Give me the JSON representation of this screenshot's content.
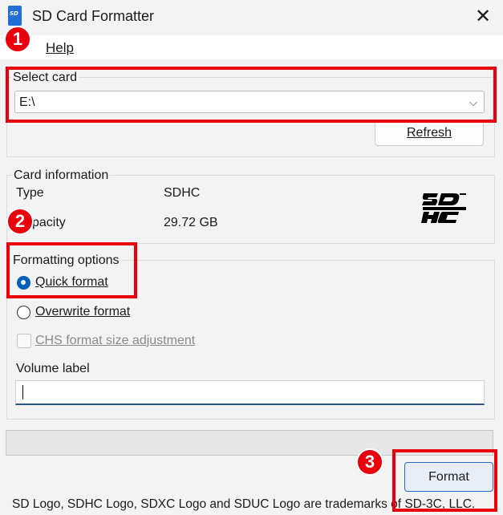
{
  "window": {
    "title": "SD Card Formatter"
  },
  "menu": {
    "help_label": "Help"
  },
  "select_card": {
    "title": "Select card",
    "value": "E:\\",
    "refresh_label": "Refresh"
  },
  "card_info": {
    "title": "Card information",
    "type_label": "Type",
    "type_value": "SDHC",
    "capacity_label": "pacity",
    "capacity_value": "29.72 GB"
  },
  "formatting": {
    "title": "Formatting options",
    "quick_label": "Quick format",
    "quick_checked": true,
    "overwrite_label": "Overwrite format",
    "overwrite_checked": false,
    "chs_label": "CHS format size adjustment",
    "chs_enabled": false,
    "volume_label_title": "Volume label",
    "volume_label_value": ""
  },
  "progress": {
    "fraction": 0
  },
  "actions": {
    "format_label": "Format"
  },
  "footer": {
    "text": "SD Logo, SDHC Logo, SDXC Logo and SDUC Logo are trademarks of SD-3C, LLC."
  },
  "annotations": {
    "badge1": "1",
    "badge2": "2",
    "badge3": "3"
  },
  "colors": {
    "annotation_red": "#e8000c",
    "accent_blue": "#005fb8"
  },
  "icons": {
    "close": "close-icon",
    "dropdown": "chevron-down-icon",
    "logo": "sdhc-logo"
  }
}
